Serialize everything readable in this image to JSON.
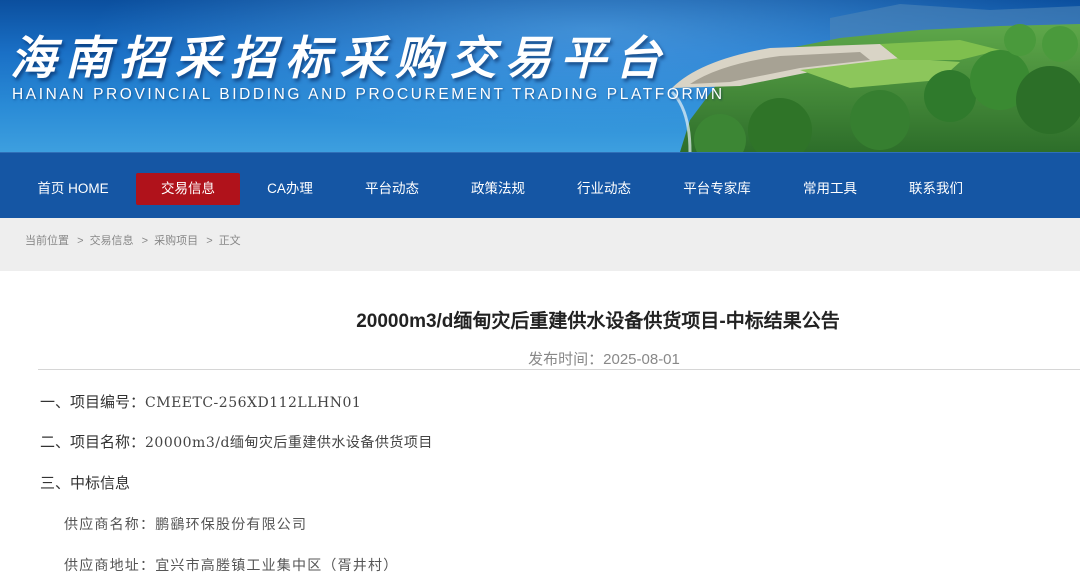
{
  "banner": {
    "title": "海南招采招标采购交易平台",
    "subtitle": "HAINAN PROVINCIAL BIDDING AND PROCUREMENT TRADING PLATFORMN"
  },
  "nav": {
    "items": [
      {
        "label": "首页 HOME"
      },
      {
        "label": "交易信息",
        "active": true
      },
      {
        "label": "CA办理"
      },
      {
        "label": "平台动态"
      },
      {
        "label": "政策法规"
      },
      {
        "label": "行业动态"
      },
      {
        "label": "平台专家库"
      },
      {
        "label": "常用工具"
      },
      {
        "label": "联系我们"
      }
    ],
    "active_color": "#b0121b",
    "bar_color": "#1556a4"
  },
  "breadcrumb": {
    "items": [
      "当前位置",
      "交易信息",
      "采购项目",
      "正文"
    ],
    "separator": ">"
  },
  "article": {
    "title": "20000m3/d缅甸灾后重建供水设备供货项目-中标结果公告",
    "date_label": "发布时间：",
    "date": "2025-08-01",
    "project_no_label": "一、项目编号：",
    "project_no": "CMEETC-256XD112LLHN01",
    "project_name_label": "二、项目名称：",
    "project_name": "20000m3/d缅甸灾后重建供水设备供货项目",
    "winner_section": "三、中标信息",
    "supplier_name_label": "供应商名称：",
    "supplier_name": "鹏鷂环保股份有限公司",
    "supplier_addr_label": "供应商地址：",
    "supplier_addr": "宜兴市高塍镇工业集中区（胥井村）"
  }
}
